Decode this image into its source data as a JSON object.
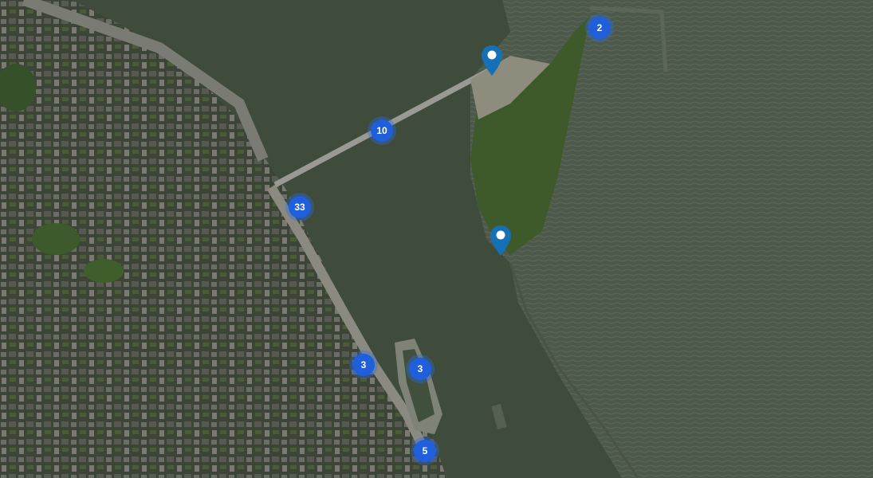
{
  "map": {
    "view": "satellite",
    "colors": {
      "cluster": "#1f5fdb",
      "pin": "#1670b5"
    },
    "clusters": [
      {
        "id": "cluster-2",
        "label": "2"
      },
      {
        "id": "cluster-10",
        "label": "10"
      },
      {
        "id": "cluster-33",
        "label": "33"
      },
      {
        "id": "cluster-3a",
        "label": "3"
      },
      {
        "id": "cluster-3b",
        "label": "3"
      },
      {
        "id": "cluster-5",
        "label": "5"
      }
    ],
    "pins": [
      {
        "id": "pin-bridge-end",
        "icon": "map-pin-icon"
      },
      {
        "id": "pin-pier",
        "icon": "map-pin-icon"
      }
    ]
  }
}
